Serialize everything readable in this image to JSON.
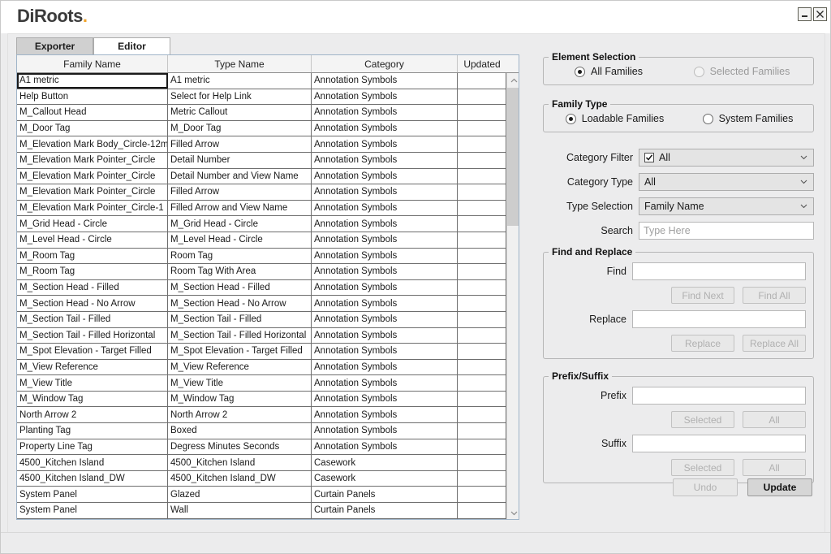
{
  "window": {
    "logo_text": "DiRoots",
    "logo_dot": ".",
    "minimize_label": "minimize",
    "close_label": "close"
  },
  "tabs": [
    {
      "label": "Exporter",
      "active": false
    },
    {
      "label": "Editor",
      "active": true
    }
  ],
  "grid": {
    "columns": [
      "Family Name",
      "Type Name",
      "Category",
      "Updated"
    ],
    "selected_row_index": 0,
    "rows": [
      [
        "A1 metric",
        "A1 metric",
        "Annotation Symbols",
        ""
      ],
      [
        "Help Button",
        "Select for Help Link",
        "Annotation Symbols",
        ""
      ],
      [
        "M_Callout Head",
        "Metric Callout",
        "Annotation Symbols",
        ""
      ],
      [
        "M_Door Tag",
        "M_Door Tag",
        "Annotation Symbols",
        ""
      ],
      [
        "M_Elevation Mark Body_Circle-12m",
        "Filled Arrow",
        "Annotation Symbols",
        ""
      ],
      [
        "M_Elevation Mark Pointer_Circle",
        "Detail Number",
        "Annotation Symbols",
        ""
      ],
      [
        "M_Elevation Mark Pointer_Circle",
        "Detail Number and View Name",
        "Annotation Symbols",
        ""
      ],
      [
        "M_Elevation Mark Pointer_Circle",
        "Filled Arrow",
        "Annotation Symbols",
        ""
      ],
      [
        "M_Elevation Mark Pointer_Circle-1",
        "Filled Arrow and View Name",
        "Annotation Symbols",
        ""
      ],
      [
        "M_Grid Head - Circle",
        "M_Grid Head - Circle",
        "Annotation Symbols",
        ""
      ],
      [
        "M_Level Head - Circle",
        "M_Level Head - Circle",
        "Annotation Symbols",
        ""
      ],
      [
        "M_Room Tag",
        "Room Tag",
        "Annotation Symbols",
        ""
      ],
      [
        "M_Room Tag",
        "Room Tag With Area",
        "Annotation Symbols",
        ""
      ],
      [
        "M_Section Head - Filled",
        "M_Section Head - Filled",
        "Annotation Symbols",
        ""
      ],
      [
        "M_Section Head - No Arrow",
        "M_Section Head - No Arrow",
        "Annotation Symbols",
        ""
      ],
      [
        "M_Section Tail - Filled",
        "M_Section Tail - Filled",
        "Annotation Symbols",
        ""
      ],
      [
        "M_Section Tail - Filled Horizontal",
        "M_Section Tail - Filled Horizontal",
        "Annotation Symbols",
        ""
      ],
      [
        "M_Spot Elevation - Target Filled",
        "M_Spot Elevation - Target Filled",
        "Annotation Symbols",
        ""
      ],
      [
        "M_View Reference",
        "M_View Reference",
        "Annotation Symbols",
        ""
      ],
      [
        "M_View Title",
        "M_View Title",
        "Annotation Symbols",
        ""
      ],
      [
        "M_Window Tag",
        "M_Window Tag",
        "Annotation Symbols",
        ""
      ],
      [
        "North Arrow 2",
        "North Arrow 2",
        "Annotation Symbols",
        ""
      ],
      [
        "Planting Tag",
        "Boxed",
        "Annotation Symbols",
        ""
      ],
      [
        "Property Line Tag",
        "Degress Minutes Seconds",
        "Annotation Symbols",
        ""
      ],
      [
        "4500_Kitchen Island",
        "4500_Kitchen Island",
        "Casework",
        ""
      ],
      [
        "4500_Kitchen Island_DW",
        "4500_Kitchen Island_DW",
        "Casework",
        ""
      ],
      [
        "System Panel",
        "Glazed",
        "Curtain Panels",
        ""
      ],
      [
        "System Panel",
        "Wall",
        "Curtain Panels",
        ""
      ]
    ]
  },
  "element_selection": {
    "legend": "Element Selection",
    "options": [
      {
        "label": "All Families",
        "checked": true,
        "disabled": false
      },
      {
        "label": "Selected Families",
        "checked": false,
        "disabled": true
      }
    ]
  },
  "family_type": {
    "legend": "Family Type",
    "options": [
      {
        "label": "Loadable Families",
        "checked": true,
        "disabled": false
      },
      {
        "label": "System Families",
        "checked": false,
        "disabled": false
      }
    ]
  },
  "filters": {
    "category_filter": {
      "label": "Category Filter",
      "value": "All",
      "checkbox_checked": true
    },
    "category_type": {
      "label": "Category Type",
      "value": "All"
    },
    "type_selection": {
      "label": "Type Selection",
      "value": "Family Name"
    },
    "search": {
      "label": "Search",
      "value": "",
      "placeholder": "Type Here"
    }
  },
  "find_replace": {
    "legend": "Find and Replace",
    "find": {
      "label": "Find",
      "value": "",
      "placeholder": ""
    },
    "find_next_label": "Find Next",
    "find_all_label": "Find All",
    "replace": {
      "label": "Replace",
      "value": "",
      "placeholder": ""
    },
    "replace_label": "Replace",
    "replace_all_label": "Replace All"
  },
  "prefix_suffix": {
    "legend": "Prefix/Suffix",
    "prefix": {
      "label": "Prefix",
      "value": "",
      "placeholder": ""
    },
    "prefix_selected_label": "Selected",
    "prefix_all_label": "All",
    "suffix": {
      "label": "Suffix",
      "value": "",
      "placeholder": ""
    },
    "suffix_selected_label": "Selected",
    "suffix_all_label": "All"
  },
  "footer": {
    "undo_label": "Undo",
    "update_label": "Update"
  }
}
